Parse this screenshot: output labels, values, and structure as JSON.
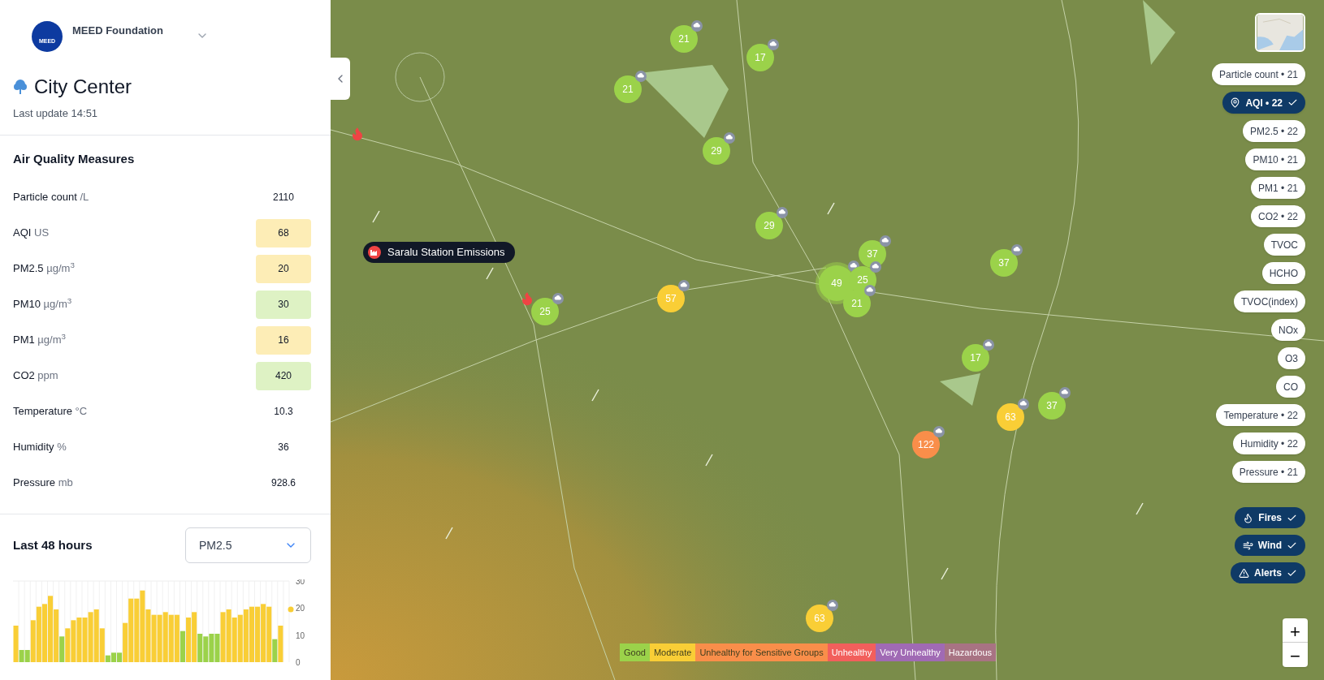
{
  "sidebar": {
    "org": {
      "logo_text": "MEED",
      "name": "MEED Foundation"
    },
    "site": {
      "title": "City Center",
      "last_update": "Last update 14:51"
    },
    "measures": {
      "title": "Air Quality Measures",
      "rows": [
        {
          "label": "Particle count",
          "unit": "/L",
          "value": "2110"
        },
        {
          "label": "AQI",
          "unit": "US",
          "value": "68",
          "color": "#fdedb6"
        },
        {
          "label": "PM2.5",
          "unit": "µg/m$^{3}$",
          "value": "20",
          "color": "#fdedb6"
        },
        {
          "label": "PM10",
          "unit": "µg/m$^{3}$",
          "value": "30",
          "color": "#def2c4"
        },
        {
          "label": "PM1",
          "unit": "µg/m$^{3}$",
          "value": "16",
          "color": "#fdedb6"
        },
        {
          "label": "CO2",
          "unit": "ppm",
          "value": "420",
          "color": "#def2c4"
        },
        {
          "label": "Temperature",
          "unit": "°C",
          "value": "10.3"
        },
        {
          "label": "Humidity",
          "unit": "%",
          "value": "36"
        },
        {
          "label": "Pressure",
          "unit": "mb",
          "value": "928.6"
        }
      ]
    },
    "history": {
      "title": "Last 48 hours",
      "select": {
        "value": "PM2.5"
      },
      "chart_data": {
        "type": "bar",
        "ylim": [
          0,
          30
        ],
        "yticks": [
          0,
          10,
          20,
          30
        ],
        "series": [
          {
            "color": "#f9ce36",
            "values": [
              13.5,
              null,
              null,
              15.5,
              20.5,
              21.5,
              24.5,
              19.5,
              null,
              12.5,
              15.5,
              16.5,
              16.5,
              18.5,
              19.5,
              12.5,
              null,
              null,
              null,
              14.5,
              23.5,
              23.5,
              26.5,
              19.5,
              17.5,
              17.5,
              18.5,
              17.5,
              17.5,
              null,
              16.5,
              18.5,
              null,
              null,
              null,
              null,
              18.5,
              19.5,
              16.5,
              17.5,
              19.5,
              20.5,
              20.5,
              21.5,
              20.5,
              null,
              13.5,
              null
            ]
          },
          {
            "color": "#9bd24a",
            "values": [
              null,
              4.5,
              4.5,
              null,
              null,
              null,
              null,
              null,
              9.5,
              null,
              null,
              null,
              null,
              null,
              null,
              null,
              2.5,
              3.5,
              3.5,
              null,
              null,
              null,
              null,
              null,
              null,
              null,
              null,
              null,
              null,
              11.5,
              null,
              null,
              10.5,
              9.5,
              10.5,
              10.5,
              null,
              null,
              null,
              null,
              null,
              null,
              null,
              null,
              null,
              8.5,
              null,
              null
            ]
          }
        ]
      }
    }
  },
  "map": {
    "popup": {
      "label": "Saralu Station Emissions"
    },
    "markers": [
      {
        "value": "21",
        "color": "#9bd24a",
        "kind": "station"
      },
      {
        "value": "17",
        "color": "#9bd24a",
        "kind": "station"
      },
      {
        "value": "21",
        "color": "#9bd24a",
        "kind": "station"
      },
      {
        "value": "29",
        "color": "#9bd24a",
        "kind": "station"
      },
      {
        "value": "29",
        "color": "#9bd24a",
        "kind": "station"
      },
      {
        "value": "37",
        "color": "#9bd24a",
        "kind": "station"
      },
      {
        "value": "49",
        "color": "#9bd24a",
        "kind": "cluster"
      },
      {
        "value": "25",
        "color": "#9bd24a",
        "kind": "station"
      },
      {
        "value": "21",
        "color": "#9bd24a",
        "kind": "station"
      },
      {
        "value": "37",
        "color": "#9bd24a",
        "kind": "station"
      },
      {
        "value": "57",
        "color": "#f9ce36",
        "kind": "station"
      },
      {
        "value": "25",
        "color": "#9bd24a",
        "kind": "station"
      },
      {
        "value": "17",
        "color": "#9bd24a",
        "kind": "station"
      },
      {
        "value": "63",
        "color": "#f9ce36",
        "kind": "station"
      },
      {
        "value": "37",
        "color": "#9bd24a",
        "kind": "station"
      },
      {
        "value": "122",
        "color": "#f98e4a",
        "kind": "station"
      },
      {
        "value": "63",
        "color": "#f9ce36",
        "kind": "station"
      }
    ],
    "layers": [
      {
        "label": "Particle count • 21",
        "selected": false
      },
      {
        "label": "AQI • 22",
        "selected": true
      },
      {
        "label": "PM2.5 • 22",
        "selected": false
      },
      {
        "label": "PM10 • 21",
        "selected": false
      },
      {
        "label": "PM1 • 21",
        "selected": false
      },
      {
        "label": "CO2 • 22",
        "selected": false
      },
      {
        "label": "TVOC",
        "selected": false
      },
      {
        "label": "HCHO",
        "selected": false
      },
      {
        "label": "TVOC(index)",
        "selected": false
      },
      {
        "label": "NOx",
        "selected": false
      },
      {
        "label": "O3",
        "selected": false
      },
      {
        "label": "CO",
        "selected": false
      },
      {
        "label": "Temperature • 22",
        "selected": false
      },
      {
        "label": "Humidity • 22",
        "selected": false
      },
      {
        "label": "Pressure • 21",
        "selected": false
      }
    ],
    "overlays": [
      {
        "label": "Fires",
        "kind": "fire",
        "selected": true
      },
      {
        "label": "Wind",
        "kind": "wind",
        "selected": true
      },
      {
        "label": "Alerts",
        "kind": "alert",
        "selected": true
      }
    ],
    "zoom": {
      "in": "+",
      "out": "−"
    },
    "legend": [
      {
        "label": "Good",
        "color": "#9bd24a"
      },
      {
        "label": "Moderate",
        "color": "#f9ce36"
      },
      {
        "label": "Unhealthy for Sensitive Groups",
        "color": "#f98e4a"
      },
      {
        "label": "Unhealthy",
        "color": "#f25f5c"
      },
      {
        "label": "Very Unhealthy",
        "color": "#a06ab4"
      },
      {
        "label": "Hazardous",
        "color": "#a87383"
      }
    ]
  }
}
